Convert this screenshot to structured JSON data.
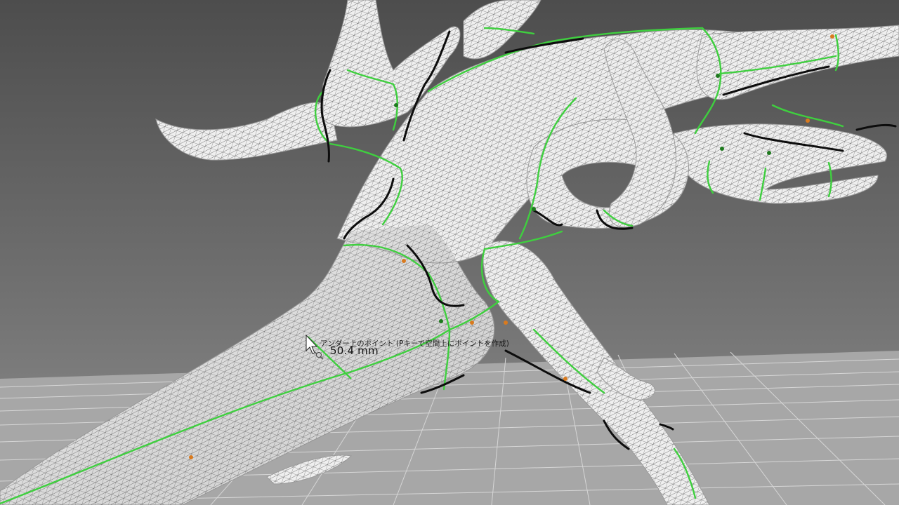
{
  "viewport": {
    "background_top": "#4f4f4f",
    "background_bottom": "#8a8a8a",
    "floor_color": "#a9a9a9",
    "grid_color": "#cfcfcf"
  },
  "model": {
    "surface_color": "#f1f1f1",
    "wire_color": "#2a2a2a",
    "boundary_color": "#3ccf3c",
    "open_edge_color": "#0f0f0f",
    "point_color": "#d97a1e"
  },
  "tooltip": {
    "hint": "アンダー上のポイント (Pキーで空間上にポイントを作成)",
    "measurement": "50.4 mm",
    "cursor_icon": "measure-cursor-icon"
  }
}
